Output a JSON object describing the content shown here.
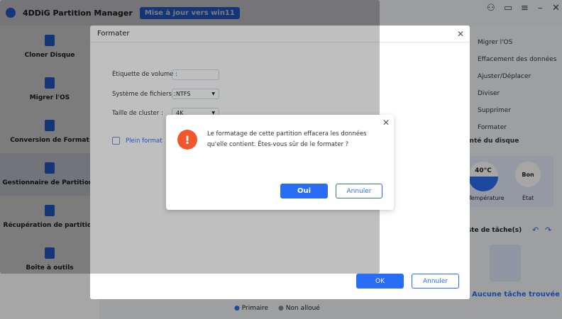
{
  "app": {
    "title": "4DDiG Partition Manager",
    "upgrade_label": "Mise à jour vers win11"
  },
  "sidebar": {
    "items": [
      {
        "label": "Cloner Disque"
      },
      {
        "label": "Migrer l'OS"
      },
      {
        "label": "Conversion de Format"
      },
      {
        "label": "Gestionnaire de Partitions"
      },
      {
        "label": "Récupération de partition"
      },
      {
        "label": "Boîte à outils"
      }
    ]
  },
  "right_panel": {
    "actions": [
      "Migrer l'OS",
      "Effacement des données",
      "Ajuster/Déplacer",
      "Diviser",
      "Supprimer",
      "Formater"
    ],
    "health_title": "Santé du disque",
    "temperature": "40°C",
    "temperature_label": "Température",
    "state": "Bon",
    "state_label": "État",
    "tasks_title": "Liste de tâche(s)",
    "no_tasks": "Aucune tâche trouvée"
  },
  "legend": {
    "primary": "Primaire",
    "unallocated": "Non alloué"
  },
  "format_dialog": {
    "title": "Formater",
    "volume_label": "Étiquette de volume :",
    "volume_value": "",
    "fs_label": "Système de fichiers :",
    "fs_value": "NTFS",
    "cluster_label": "Taille de cluster :",
    "cluster_value": "4K",
    "full_format": "Plein format",
    "ok": "OK",
    "cancel": "Annuler"
  },
  "confirm_dialog": {
    "message": "Le formatage de cette partition effacera les données qu'elle contient. Êtes-vous sûr de le formater ?",
    "yes": "Oui",
    "cancel": "Annuler"
  }
}
